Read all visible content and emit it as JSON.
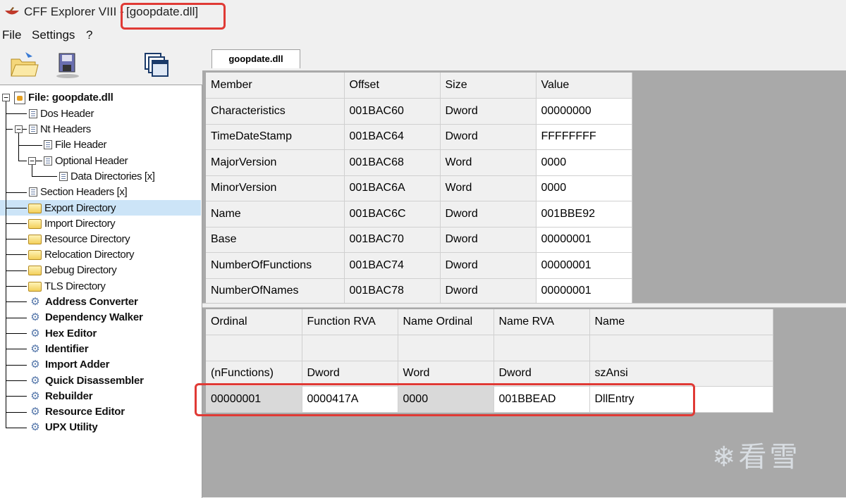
{
  "window": {
    "app_title": "CFF Explorer VIII - ",
    "file_title": "[goopdate.dll]"
  },
  "menu": [
    "File",
    "Settings",
    "?"
  ],
  "toolbar": {
    "icons": [
      "open-file-icon",
      "save-icon",
      "windows-icon"
    ]
  },
  "tab": {
    "label": "goopdate.dll"
  },
  "tree": {
    "root": "File: goopdate.dll",
    "items": [
      {
        "label": "Dos Header",
        "icon": "doc-icon"
      },
      {
        "label": "Nt Headers",
        "icon": "doc-icon"
      },
      {
        "label": "File Header",
        "icon": "doc-icon"
      },
      {
        "label": "Optional Header",
        "icon": "doc-icon"
      },
      {
        "label": "Data Directories [x]",
        "icon": "doc-icon"
      },
      {
        "label": "Section Headers [x]",
        "icon": "doc-icon"
      },
      {
        "label": "Export Directory",
        "icon": "folder-icon"
      },
      {
        "label": "Import Directory",
        "icon": "folder-icon"
      },
      {
        "label": "Resource Directory",
        "icon": "folder-icon"
      },
      {
        "label": "Relocation Directory",
        "icon": "folder-icon"
      },
      {
        "label": "Debug Directory",
        "icon": "folder-icon"
      },
      {
        "label": "TLS Directory",
        "icon": "folder-icon"
      },
      {
        "label": "Address Converter",
        "icon": "tool-icon"
      },
      {
        "label": "Dependency Walker",
        "icon": "tool-icon"
      },
      {
        "label": "Hex Editor",
        "icon": "tool-icon"
      },
      {
        "label": "Identifier",
        "icon": "tool-icon"
      },
      {
        "label": "Import Adder",
        "icon": "tool-icon"
      },
      {
        "label": "Quick Disassembler",
        "icon": "tool-icon"
      },
      {
        "label": "Rebuilder",
        "icon": "tool-icon"
      },
      {
        "label": "Resource Editor",
        "icon": "tool-icon"
      },
      {
        "label": "UPX Utility",
        "icon": "tool-icon"
      }
    ]
  },
  "export_table": {
    "headers": [
      "Member",
      "Offset",
      "Size",
      "Value"
    ],
    "rows": [
      [
        "Characteristics",
        "001BAC60",
        "Dword",
        "00000000"
      ],
      [
        "TimeDateStamp",
        "001BAC64",
        "Dword",
        "FFFFFFFF"
      ],
      [
        "MajorVersion",
        "001BAC68",
        "Word",
        "0000"
      ],
      [
        "MinorVersion",
        "001BAC6A",
        "Word",
        "0000"
      ],
      [
        "Name",
        "001BAC6C",
        "Dword",
        "001BBE92"
      ],
      [
        "Base",
        "001BAC70",
        "Dword",
        "00000001"
      ],
      [
        "NumberOfFunctions",
        "001BAC74",
        "Dword",
        "00000001"
      ],
      [
        "NumberOfNames",
        "001BAC78",
        "Dword",
        "00000001"
      ]
    ]
  },
  "functions_table": {
    "headers": [
      "Ordinal",
      "Function RVA",
      "Name Ordinal",
      "Name RVA",
      "Name"
    ],
    "types": [
      "(nFunctions)",
      "Dword",
      "Word",
      "Dword",
      "szAnsi"
    ],
    "rows": [
      [
        "00000001",
        "0000417A",
        "0000",
        "001BBEAD",
        "DllEntry"
      ]
    ]
  },
  "watermark": "看雪",
  "colors": {
    "highlight": "#e03a35",
    "selection": "#cce4f7"
  }
}
